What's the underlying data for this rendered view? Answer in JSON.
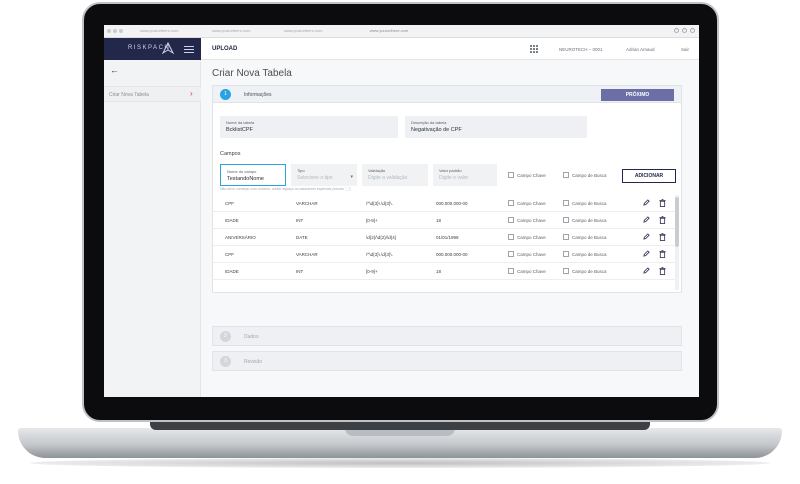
{
  "browser": {
    "url": "www.yoururlhere.com",
    "tabs": [
      "www.yoururlhere.com",
      "www.yoururlhere.com",
      "www.yoururlhere.com"
    ]
  },
  "app": {
    "brand": "RISKPACK",
    "page": "UPLOAD",
    "org": "NEUROTECH – 0001",
    "user": "Adrian Arnaud",
    "logout": "Sair"
  },
  "sidebar": {
    "back_icon": "arrow-left-icon",
    "item": "Criar Nova Tabela"
  },
  "main": {
    "title": "Criar Nova Tabela",
    "steps": [
      {
        "num": "1",
        "label": "Informações"
      },
      {
        "num": "2",
        "label": "Dados"
      },
      {
        "num": "3",
        "label": "Revisão"
      }
    ],
    "next_button": "PRÓXIMO",
    "table_name": {
      "label": "Nome da tabela",
      "value": "BcklistCPF"
    },
    "table_desc": {
      "label": "Descrição da tabela",
      "value": "Negativação de CPF"
    },
    "campos_title": "Campos",
    "new_field": {
      "name": {
        "label": "Nome do campo",
        "value": "TestandoNome"
      },
      "type": {
        "label": "Tipo",
        "placeholder": "Selecione o tipo"
      },
      "validation": {
        "label": "Validação",
        "placeholder": "Digite a validação"
      },
      "default": {
        "label": "Valor padrão",
        "placeholder": "Digite o valor"
      },
      "hint": "Não deve começar com número, conter espaço ou caracteres especiais (exceto \"_\")",
      "key_label": "Campo Chave",
      "search_label": "Campo de Busca",
      "add_button": "ADICIONAR"
    },
    "rows": [
      {
        "name": "CPF",
        "type": "VARCHAR",
        "validation": "/^\\d{3}\\.\\d{3}\\.",
        "default": "000.000.000-00"
      },
      {
        "name": "IDADE",
        "type": "INT",
        "validation": "[0-9]+",
        "default": "18"
      },
      {
        "name": "ANIVERSÁRIO",
        "type": "DATE",
        "validation": "\\d{2}/\\d{2}/\\d{4}",
        "default": "01/01/1999"
      },
      {
        "name": "CPF",
        "type": "VARCHAR",
        "validation": "/^\\d{3}\\.\\d{3}\\.",
        "default": "000.000.000-00"
      },
      {
        "name": "IDADE",
        "type": "INT",
        "validation": "[0-9]+",
        "default": "18"
      }
    ],
    "row_labels": {
      "key": "Campo Chave",
      "search": "Campo de Busca"
    }
  },
  "colors": {
    "brand": "#23284a",
    "accent": "#2aa3e0",
    "button": "#6b6fa6",
    "danger": "#d23a4a"
  }
}
